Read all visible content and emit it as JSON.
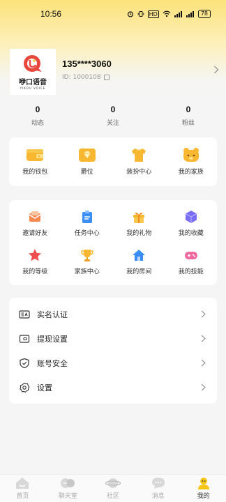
{
  "status_bar": {
    "time": "10:56",
    "hd_label": "HD",
    "battery": "78",
    "icons": [
      "alarm-icon",
      "vibrate-icon",
      "hd-icon",
      "wifi-icon",
      "signal-icon",
      "signal-icon",
      "battery-icon"
    ]
  },
  "profile": {
    "avatar_text": "咿口语音",
    "avatar_sub": "YIKOU VOICE",
    "name": "135****3060",
    "id": "ID: 1000108"
  },
  "stats": [
    {
      "value": "0",
      "label": "动态"
    },
    {
      "value": "0",
      "label": "关注"
    },
    {
      "value": "0",
      "label": "粉丝"
    }
  ],
  "section1": [
    {
      "label": "我的钱包",
      "icon": "wallet-icon"
    },
    {
      "label": "爵位",
      "icon": "diamond-icon"
    },
    {
      "label": "装扮中心",
      "icon": "tshirt-icon"
    },
    {
      "label": "我的家族",
      "icon": "bear-icon"
    }
  ],
  "section2": [
    {
      "label": "邀请好友",
      "icon": "envelope-icon"
    },
    {
      "label": "任务中心",
      "icon": "clipboard-icon"
    },
    {
      "label": "我的礼物",
      "icon": "gift-icon"
    },
    {
      "label": "我的收藏",
      "icon": "cube-icon"
    },
    {
      "label": "我的等级",
      "icon": "star-icon"
    },
    {
      "label": "家族中心",
      "icon": "trophy-icon"
    },
    {
      "label": "我的房间",
      "icon": "house-icon"
    },
    {
      "label": "我的技能",
      "icon": "gamepad-icon"
    }
  ],
  "menu": [
    {
      "label": "实名认证",
      "icon": "id-card-icon"
    },
    {
      "label": "提现设置",
      "icon": "wallet-outline-icon"
    },
    {
      "label": "账号安全",
      "icon": "shield-icon"
    },
    {
      "label": "设置",
      "icon": "gear-icon"
    }
  ],
  "tabs": [
    {
      "label": "首页",
      "icon": "home-icon"
    },
    {
      "label": "聊天室",
      "icon": "chat-room-icon"
    },
    {
      "label": "社区",
      "icon": "planet-icon"
    },
    {
      "label": "消息",
      "icon": "message-icon"
    },
    {
      "label": "我的",
      "icon": "user-icon",
      "active": true
    }
  ],
  "colors": {
    "accent": "#f5c518",
    "icon_yellow": "#f7b731",
    "icon_red": "#f04e4e",
    "icon_blue": "#3a8ef6",
    "icon_purple": "#7b6ef6",
    "icon_pink": "#f06aa0"
  }
}
